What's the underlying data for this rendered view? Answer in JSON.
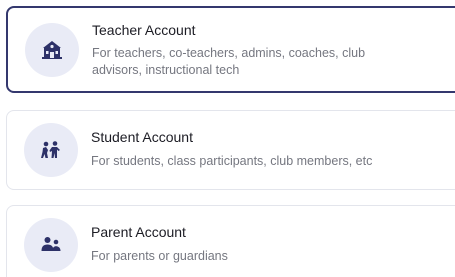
{
  "accounts": [
    {
      "title": "Teacher Account",
      "description": "For teachers, co-teachers, admins, coaches, club advisors, instructional tech",
      "icon": "school-building-icon",
      "selected": true
    },
    {
      "title": "Student Account",
      "description": "For students, class participants, club members, etc",
      "icon": "students-group-icon",
      "selected": false
    },
    {
      "title": "Parent Account",
      "description": "For parents or guardians",
      "icon": "parent-child-icon",
      "selected": false
    }
  ],
  "colors": {
    "selected_border": "#34386e",
    "card_border": "#e3e5ec",
    "icon_background": "#e9ebf6",
    "icon_color": "#2d3168",
    "title_text": "#1c1c24",
    "description_text": "#757780"
  }
}
